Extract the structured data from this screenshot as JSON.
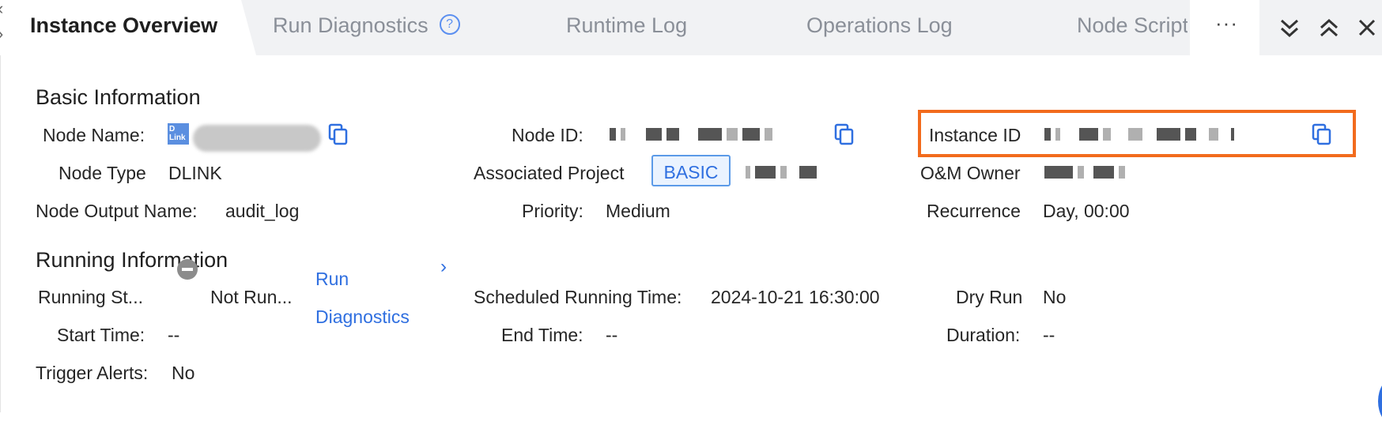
{
  "tabs": [
    {
      "label": "Instance Overview",
      "active": true
    },
    {
      "label": "Run Diagnostics"
    },
    {
      "label": "Runtime Log"
    },
    {
      "label": "Operations Log"
    },
    {
      "label": "Node Script"
    }
  ],
  "more_label": "···",
  "basic": {
    "title": "Basic Information",
    "node_name_label": "Node Name:",
    "node_id_label": "Node ID:",
    "instance_id_label": "Instance ID",
    "node_type_label": "Node Type",
    "node_type_value": "DLINK",
    "associated_project_label": "Associated Project",
    "project_tag": "BASIC",
    "om_owner_label": "O&M Owner",
    "node_output_label": "Node Output Name:",
    "node_output_value": "audit_log",
    "priority_label": "Priority:",
    "priority_value": "Medium",
    "recurrence_label": "Recurrence",
    "recurrence_value": "Day, 00:00"
  },
  "logo_text": "D Link",
  "running": {
    "title": "Running Information",
    "status_label": "Running St...",
    "status_value": "Not Run...",
    "run_diag_line1": "Run",
    "run_diag_line2": "Diagnostics",
    "scheduled_label": "Scheduled Running Time:",
    "scheduled_value": "2024-10-21 16:30:00",
    "dry_run_label": "Dry Run",
    "dry_run_value": "No",
    "start_label": "Start Time:",
    "start_value": "--",
    "end_label": "End Time:",
    "end_value": "--",
    "duration_label": "Duration:",
    "duration_value": "--",
    "trigger_label": "Trigger Alerts:",
    "trigger_value": "No"
  },
  "colors": {
    "accent": "#2f6fe0",
    "highlight": "#f26b1d",
    "tab_bg": "#f1f2f4"
  }
}
